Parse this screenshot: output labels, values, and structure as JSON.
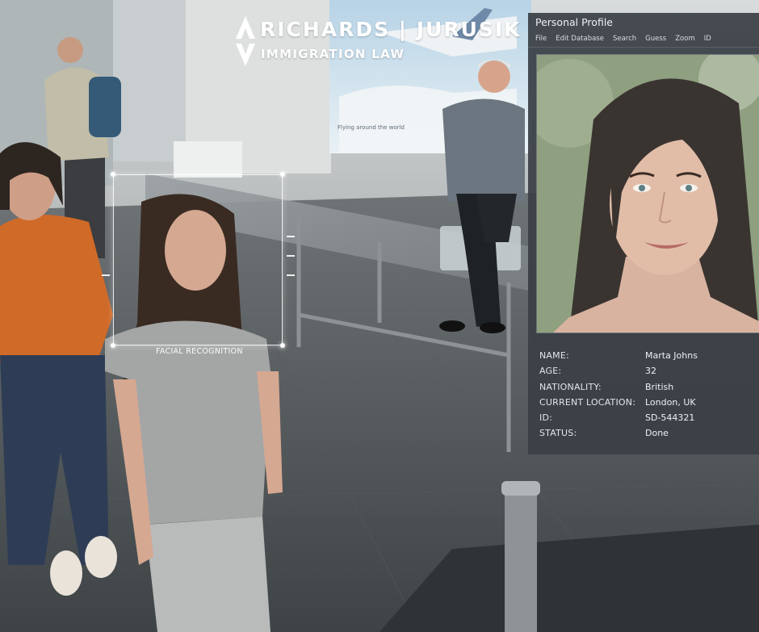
{
  "brand": {
    "name": "RICHARDS | JURUSIK",
    "tagline": "IMMIGRATION LAW",
    "logo_icon": "chevron-mark-icon"
  },
  "scene": {
    "overlay_label": "FACIAL RECOGNITION",
    "poster_text": "Flying around the world"
  },
  "profile_window": {
    "title": "Personal Profile",
    "menu": [
      "File",
      "Edit Database",
      "Search",
      "Guess",
      "Zoom",
      "ID"
    ],
    "fields": [
      {
        "label": "NAME:",
        "value": "Marta Johns"
      },
      {
        "label": "AGE:",
        "value": "32"
      },
      {
        "label": "NATIONALITY:",
        "value": "British"
      },
      {
        "label": "CURRENT LOCATION:",
        "value": "London, UK"
      },
      {
        "label": "ID:",
        "value": "SD-544321"
      },
      {
        "label": "STATUS:",
        "value": "Done"
      }
    ]
  },
  "colors": {
    "panel": "#3a4046",
    "text": "#e8ecef",
    "logo": "#ffffff"
  }
}
